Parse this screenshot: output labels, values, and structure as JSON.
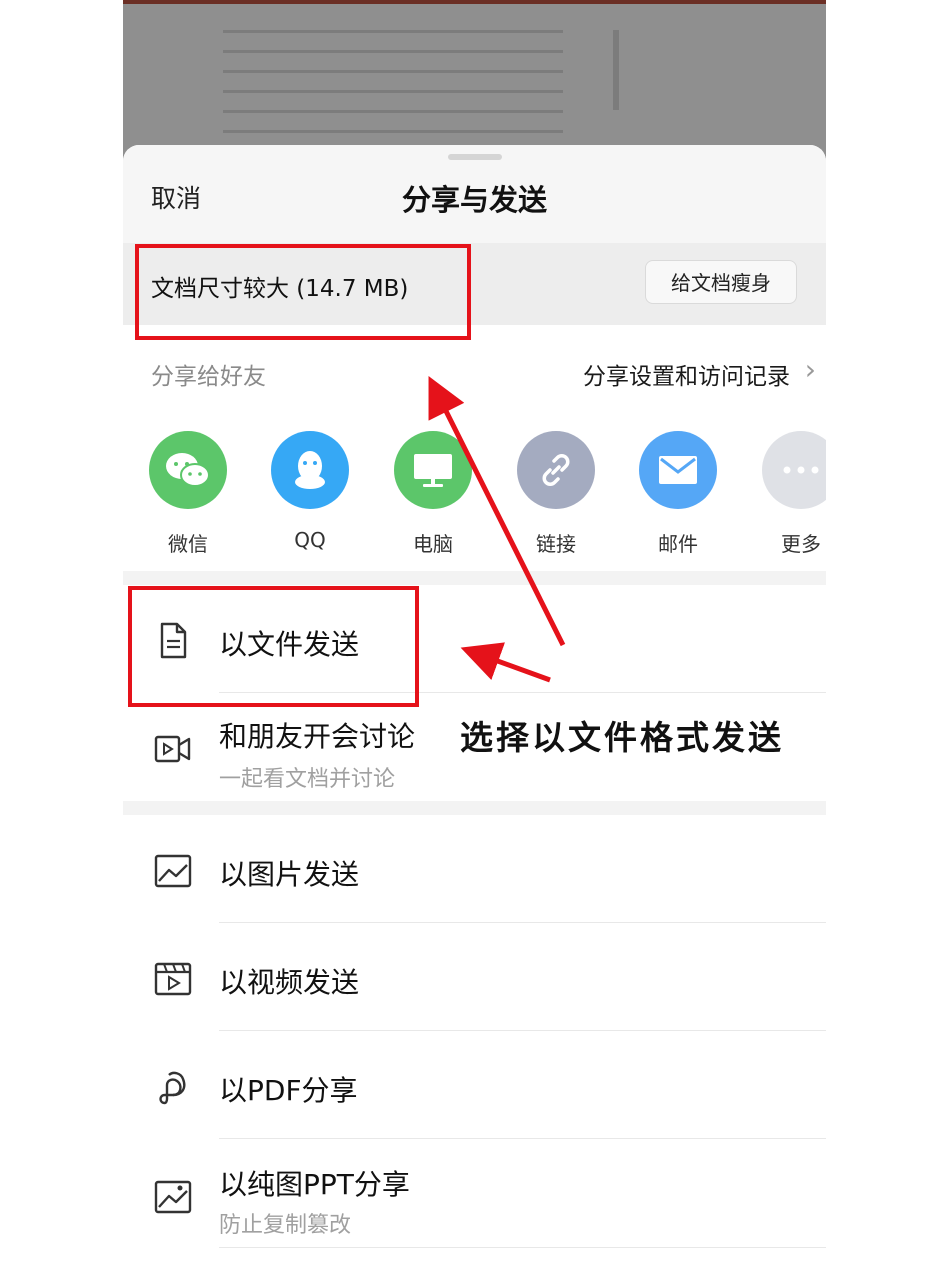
{
  "sheet": {
    "cancel_label": "取消",
    "title": "分享与发送"
  },
  "size_bar": {
    "message": "文档尺寸较大 (14.7 MB)",
    "slim_button": "给文档瘦身"
  },
  "share": {
    "label": "分享给好友",
    "settings_link": "分享设置和访问记录",
    "apps": [
      {
        "label": "微信",
        "icon": "wechat-icon",
        "color": "#5cc66a"
      },
      {
        "label": "QQ",
        "icon": "qq-icon",
        "color": "#36a8f5"
      },
      {
        "label": "电脑",
        "icon": "computer-icon",
        "color": "#5cc66a"
      },
      {
        "label": "链接",
        "icon": "link-icon",
        "color": "#a4abc0"
      },
      {
        "label": "邮件",
        "icon": "mail-icon",
        "color": "#55a7f6"
      },
      {
        "label": "更多",
        "icon": "more-icon",
        "color": "#dfe1e6"
      }
    ]
  },
  "options": [
    {
      "title": "以文件发送",
      "icon": "file-icon"
    },
    {
      "title": "和朋友开会讨论",
      "subtitle": "一起看文档并讨论",
      "icon": "video-meeting-icon"
    },
    {
      "title": "以图片发送",
      "icon": "image-icon"
    },
    {
      "title": "以视频发送",
      "icon": "video-clip-icon"
    },
    {
      "title": "以PDF分享",
      "icon": "pdf-icon"
    },
    {
      "title": "以纯图PPT分享",
      "subtitle": "防止复制篡改",
      "icon": "picture-ppt-icon"
    }
  ],
  "annotation": {
    "text": "选择以文件格式发送",
    "color": "#e5121a"
  }
}
